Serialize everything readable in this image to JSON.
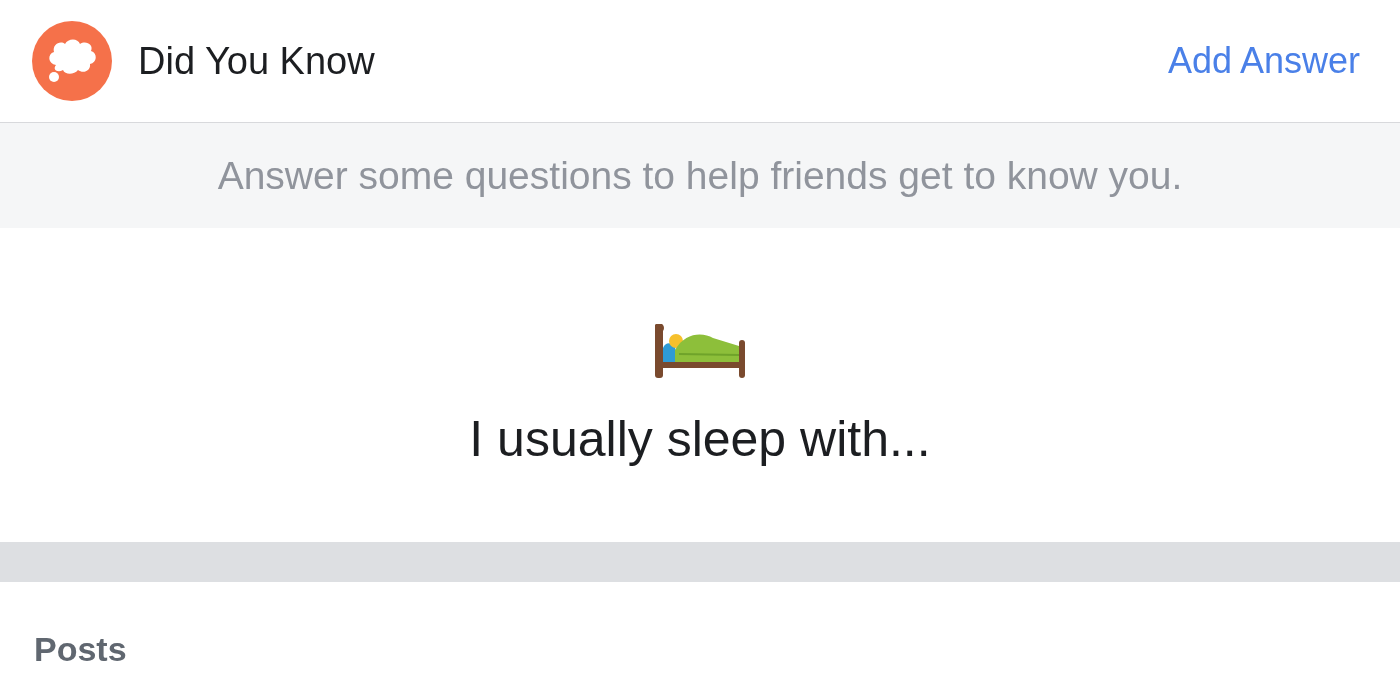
{
  "header": {
    "title": "Did You Know",
    "action": "Add Answer"
  },
  "prompt": "Answer some questions to help friends get to know you.",
  "question": {
    "text": "I usually sleep with..."
  },
  "section": {
    "title": "Posts"
  }
}
